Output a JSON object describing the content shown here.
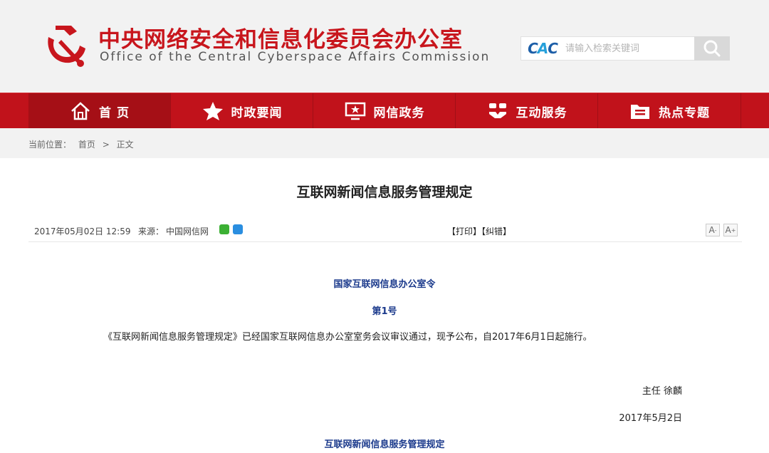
{
  "header": {
    "title": "中央网络安全和信息化委员会办公室",
    "subtitle": "Office of the Central Cyberspace Affairs Commission",
    "search_logo": [
      "C",
      "A",
      "C"
    ],
    "search_placeholder": "请输入检索关键词"
  },
  "nav": {
    "items": [
      {
        "label": "首 页",
        "icon": "home-icon"
      },
      {
        "label": "时政要闻",
        "icon": "star-icon"
      },
      {
        "label": "网信政务",
        "icon": "monitor-icon"
      },
      {
        "label": "互动服务",
        "icon": "handshake-icon"
      },
      {
        "label": "热点专题",
        "icon": "folder-icon"
      }
    ]
  },
  "breadcrumb": {
    "prefix": "当前位置：",
    "home": "首页",
    "sep": ">",
    "current": "正文"
  },
  "article": {
    "title": "互联网新闻信息服务管理规定",
    "date": "2017年05月02日 12:59",
    "source_label": "来源：",
    "source": "中国网信网",
    "actions": "【打印】【纠错】",
    "font_small": "A",
    "font_large": "A",
    "order_title": "国家互联网信息办公室令",
    "order_no": "第1号",
    "paragraph": "《互联网新闻信息服务管理规定》已经国家互联网信息办公室室务会议审议通过，现予公布，自2017年6月1日起施行。",
    "signer": "主任  徐麟",
    "sign_date": "2017年5月2日",
    "section_title": "互联网新闻信息服务管理规定"
  },
  "colors": {
    "brand_red": "#c1121b",
    "header_bg": "#f2f2f2",
    "heading_blue": "#1b3a8c"
  }
}
